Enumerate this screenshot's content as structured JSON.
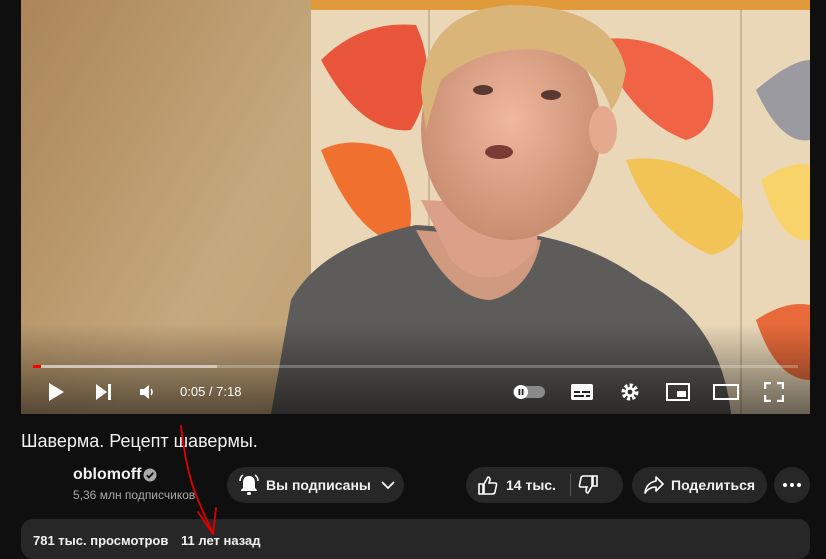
{
  "player": {
    "time_display": "0:05 / 7:18",
    "progress_fraction": 0.011,
    "buffered_fraction": 0.24
  },
  "video": {
    "title": "Шаверма. Рецепт шавермы."
  },
  "channel": {
    "name": "oblomoff",
    "subscribers": "5,36 млн подписчиков",
    "subscribe_label": "Вы подписаны"
  },
  "actions": {
    "likes": "14 тыс.",
    "share_label": "Поделиться"
  },
  "description": {
    "views": "781 тыс. просмотров",
    "age": "11 лет назад"
  },
  "colors": {
    "background": "#0f0f0f",
    "pill": "#272727",
    "progress": "#ff0000",
    "annotation": "#e00000"
  },
  "icons": [
    "play-icon",
    "next-icon",
    "volume-icon",
    "autoplay-toggle-icon",
    "subtitles-icon",
    "settings-icon",
    "miniplayer-icon",
    "theater-icon",
    "fullscreen-icon",
    "bell-icon",
    "chevron-down-icon",
    "thumbs-up-icon",
    "thumbs-down-icon",
    "share-icon",
    "more-icon",
    "verified-icon"
  ]
}
